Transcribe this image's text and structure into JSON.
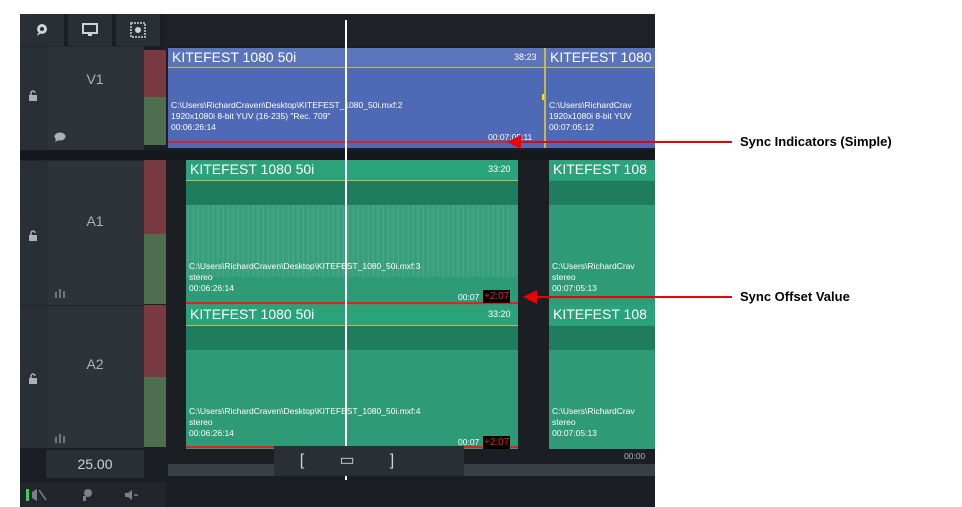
{
  "toolbar": {
    "icons": [
      "chat-bubble-icon",
      "monitor-icon",
      "film-frame-icon"
    ]
  },
  "tracks": [
    {
      "name": "V1",
      "lock_icon": "lock-icon",
      "sub_icon": "comment-icon"
    },
    {
      "name": "A1",
      "lock_icon": "lock-icon",
      "sub_icon": "waveform-meter-icon"
    },
    {
      "name": "A2",
      "lock_icon": "lock-icon",
      "sub_icon": "waveform-meter-icon"
    }
  ],
  "framerate": "25.00",
  "transport": {
    "in_label": "[",
    "clip_label": "▭",
    "out_label": "]"
  },
  "bottom_icons": [
    "audio-mute-icon",
    "patch-icon",
    "speaker-remove-icon"
  ],
  "clips": {
    "v1_a": {
      "title": "KITEFEST 1080 50i",
      "duration": "38:23",
      "path": "C:\\Users\\RichardCraven\\Desktop\\KITEFEST_1080_50i.mxf:2",
      "format": "1920x1080i 8-bit YUV (16-235) \"Rec. 709\"",
      "tc_in": "00:06:26:14",
      "tc_out": "00:07:05:11"
    },
    "v1_b": {
      "title": "KITEFEST 1080",
      "path": "C:\\Users\\RichardCrav",
      "format": "1920x1080i 8-bit YUV",
      "tc_in": "00:07:05:12"
    },
    "a1_a": {
      "title": "KITEFEST 1080 50i",
      "duration": "33:20",
      "path": "C:\\Users\\RichardCraven\\Desktop\\KITEFEST_1080_50i.mxf:3",
      "type": "stereo",
      "tc_in": "00:06:26:14",
      "tc_out": "00:07",
      "offset": "+2:07"
    },
    "a1_b": {
      "title": "KITEFEST 108",
      "path": "C:\\Users\\RichardCrav",
      "type": "stereo",
      "tc_in": "00:07:05:13"
    },
    "a2_a": {
      "title": "KITEFEST 1080 50i",
      "duration": "33:20",
      "path": "C:\\Users\\RichardCraven\\Desktop\\KITEFEST_1080_50i.mxf:4",
      "type": "stereo",
      "tc_in": "00:06:26:14",
      "tc_out": "00:07",
      "offset": "+2:07"
    },
    "a2_b": {
      "title": "KITEFEST 108",
      "path": "C:\\Users\\RichardCrav",
      "type": "stereo",
      "tc_in": "00:07:05:13"
    }
  },
  "ruler_tail": "00:00",
  "callouts": {
    "sync_indicators": "Sync Indicators (Simple)",
    "sync_offset": "Sync Offset Value"
  },
  "colors": {
    "video_clip": "#4e69b5",
    "audio_clip": "#2e9a76",
    "audio_clip_dark": "#1f7d5e",
    "sync_red": "#d22222",
    "playhead": "#ffffff"
  }
}
